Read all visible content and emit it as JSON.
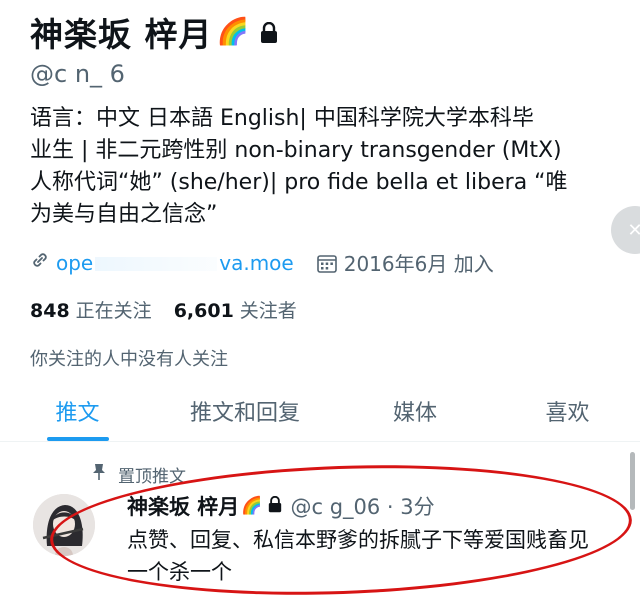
{
  "profile": {
    "display_name": "神楽坂 梓月",
    "name_emoji": "🌈",
    "handle": "@c    n_   6",
    "bio_lines": [
      "语言：中文 日本語 English| 中国科学院大学本科毕",
      "业生 | 非二元跨性别 non-binary transgender (MtX)",
      "人称代词“她” (she/her)| pro fide bella et libera “唯",
      "为美与自由之信念”"
    ],
    "link_prefix": "ope",
    "link_suffix": "va.moe",
    "joined": "2016年6月 加入",
    "following_count": "848",
    "following_label": "正在关注",
    "followers_count": "6,601",
    "followers_label": "关注者",
    "followed_by": "你关注的人中没有人关注"
  },
  "tabs": [
    {
      "label": "推文",
      "active": true
    },
    {
      "label": "推文和回复",
      "active": false
    },
    {
      "label": "媒体",
      "active": false
    },
    {
      "label": "喜欢",
      "active": false
    }
  ],
  "pinned_label": "置顶推文",
  "tweet": {
    "author": "神楽坂 梓月",
    "author_emoji": "🌈",
    "handle_time": "@c    g_06 · 3分",
    "text": "点赞、回复、私信本野爹的拆腻子下等爱国贱畜见一个杀一个"
  },
  "colors": {
    "accent": "#1d9bf0",
    "annotation_circle": "#d71414",
    "secondary_text": "#536471"
  }
}
